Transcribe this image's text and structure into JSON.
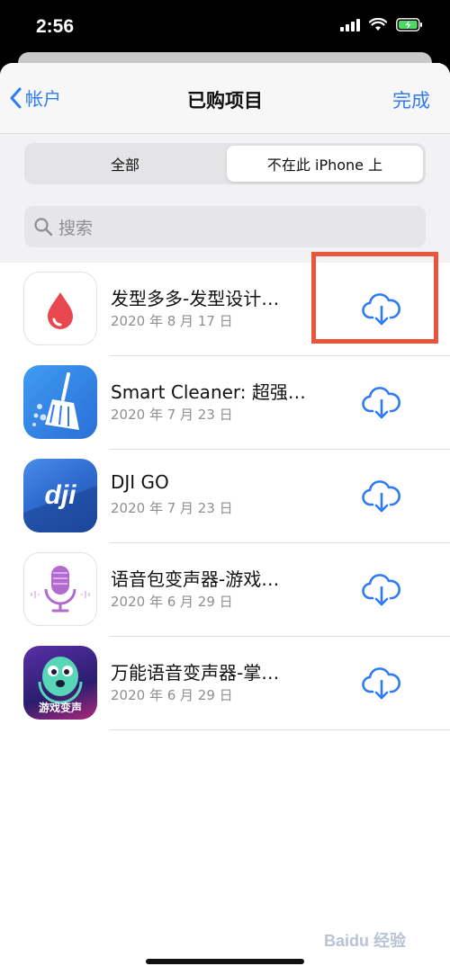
{
  "status_bar": {
    "time": "2:56",
    "icons": [
      "signal-icon",
      "wifi-icon",
      "battery-charging-icon"
    ]
  },
  "nav": {
    "back_label": "帐户",
    "title": "已购项目",
    "done_label": "完成"
  },
  "segments": {
    "all": "全部",
    "not_on_device": "不在此 iPhone 上",
    "selected": "not_on_device"
  },
  "search": {
    "placeholder": "搜索"
  },
  "apps": [
    {
      "name": "发型多多-发型设计…",
      "date": "2020 年 8 月 17 日",
      "icon": "blood-drop-icon"
    },
    {
      "name": "Smart Cleaner: 超强…",
      "date": "2020 年 7 月 23 日",
      "icon": "broom-icon"
    },
    {
      "name": "DJI GO",
      "date": "2020 年 7 月 23 日",
      "icon": "dji-logo-icon"
    },
    {
      "name": "语音包变声器-游戏…",
      "date": "2020 年 6 月 29 日",
      "icon": "microphone-icon"
    },
    {
      "name": "万能语音变声器-掌…",
      "date": "2020 年 6 月 29 日",
      "icon": "monster-face-icon",
      "icon_text": "游戏变声"
    }
  ],
  "colors": {
    "accent": "#2f7bf6",
    "highlight_box": "#e8553a"
  },
  "watermark": "Baidu 经验"
}
